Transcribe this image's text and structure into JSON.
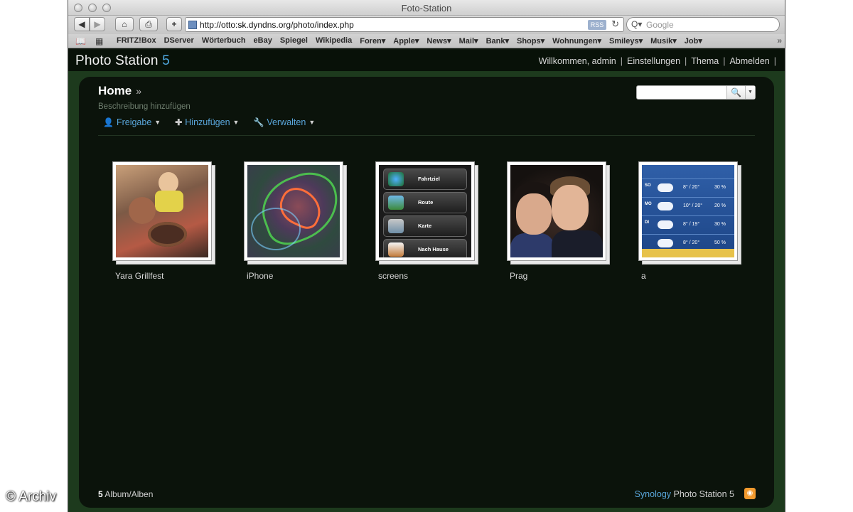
{
  "browser": {
    "window_title": "Foto-Station",
    "url": "http://̸̸t̸̸̸k.dyndns.org/photo/index.php",
    "url_display": "http://otto:s̶k.dyndns.org/photo/index.php",
    "rss_badge": "RSS",
    "search_placeholder": "Google",
    "bookmarks": [
      "FRITZ!Box",
      "DServer",
      "Wörterbuch",
      "eBay",
      "Spiegel",
      "Wikipedia",
      "Foren▾",
      "Apple▾",
      "News▾",
      "Mail▾",
      "Bank▾",
      "Shops▾",
      "Wohnungen▾",
      "Smileys▾",
      "Musik▾",
      "Job▾"
    ],
    "bookmarks_more": "»"
  },
  "app": {
    "brand": "Photo Station",
    "brand_version": "5",
    "user_nav": [
      "Willkommen, admin",
      "Einstellungen",
      "Thema",
      "Abmelden"
    ]
  },
  "main": {
    "breadcrumb": "Home",
    "breadcrumb_sep": "»",
    "description": "Beschreibung hinzufügen",
    "actions": [
      {
        "label": "Freigabe",
        "icon": "user-icon"
      },
      {
        "label": "Hinzufügen",
        "icon": "plus-icon"
      },
      {
        "label": "Verwalten",
        "icon": "wrench-icon"
      }
    ],
    "albums": [
      {
        "label": "Yara Grillfest"
      },
      {
        "label": "iPhone"
      },
      {
        "label": "screens"
      },
      {
        "label": "Prag"
      },
      {
        "label": "a"
      }
    ],
    "screens_menu": [
      "Fahrtziel",
      "Route",
      "Karte",
      "Nach Hause"
    ],
    "weather_rows": [
      {
        "day": "SO",
        "temp": "8° / 20°",
        "pct": "30 %"
      },
      {
        "day": "MO",
        "temp": "10° / 20°",
        "pct": "20 %"
      },
      {
        "day": "DI",
        "temp": "8° / 19°",
        "pct": "30 %"
      },
      {
        "day": "",
        "temp": "8° / 20°",
        "pct": "50 %"
      }
    ]
  },
  "footer": {
    "album_count": "5",
    "album_count_label": "Album/Alben",
    "credit_brand": "Synology",
    "credit_product": "Photo Station 5"
  },
  "watermark": "© Archiv",
  "colors": {
    "accent_blue": "#5aa7dc",
    "frame_green": "#1d3a1d",
    "panel_bg": "#0b130b"
  }
}
